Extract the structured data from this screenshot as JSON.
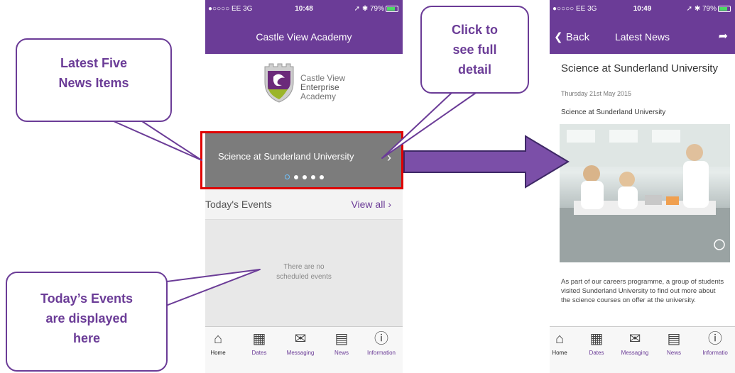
{
  "phone1": {
    "status": {
      "carrier": "●○○○○ EE  3G",
      "time": "10:48",
      "battery": "➚ ✱ 79%"
    },
    "nav_title": "Castle View Academy",
    "logo": {
      "line1": "Castle View",
      "line2": "Enterprise",
      "line3": "Academy"
    },
    "news": {
      "title": "Science at Sunderland University",
      "chevron": "›",
      "dots": 5,
      "active_dot": 1
    },
    "events": {
      "label": "Today's Events",
      "view_all": "View all  ›",
      "empty_line1": "There are no",
      "empty_line2": "scheduled events"
    },
    "tabs": [
      {
        "icon": "⌂",
        "label": "Home"
      },
      {
        "icon": "▦",
        "label": "Dates"
      },
      {
        "icon": "✉",
        "label": "Messaging"
      },
      {
        "icon": "▤",
        "label": "News"
      },
      {
        "icon": "ⓘ",
        "label": "Information"
      }
    ]
  },
  "phone2": {
    "status": {
      "carrier": "●○○○○ EE  3G",
      "time": "10:49",
      "battery": "➚ ✱ 79%"
    },
    "back": "❮ Back",
    "nav_title": "Latest News",
    "share": "➦",
    "article": {
      "title": "Science at Sunderland University",
      "date": "Thursday 21st May 2015",
      "subtitle": "Science at Sunderland University",
      "body": "As part of our careers programme, a group of students visited Sunderland University to find out more about the science courses on offer at the university."
    },
    "tabs": [
      {
        "icon": "⌂",
        "label": "Home"
      },
      {
        "icon": "▦",
        "label": "Dates"
      },
      {
        "icon": "✉",
        "label": "Messaging"
      },
      {
        "icon": "▤",
        "label": "News"
      },
      {
        "icon": "ⓘ",
        "label": "Informatio"
      }
    ]
  },
  "callouts": {
    "latest": {
      "line1": "Latest Five",
      "line2": "News Items"
    },
    "click": {
      "line1": "Click to",
      "line2": "see full",
      "line3": "detail"
    },
    "events": {
      "line1": "Today’s Events",
      "line2": "are displayed",
      "line3": "here"
    }
  },
  "colors": {
    "brand_purple": "#6b3c97",
    "highlight_red": "#e00000",
    "slide_grey": "#7c7c7c"
  }
}
